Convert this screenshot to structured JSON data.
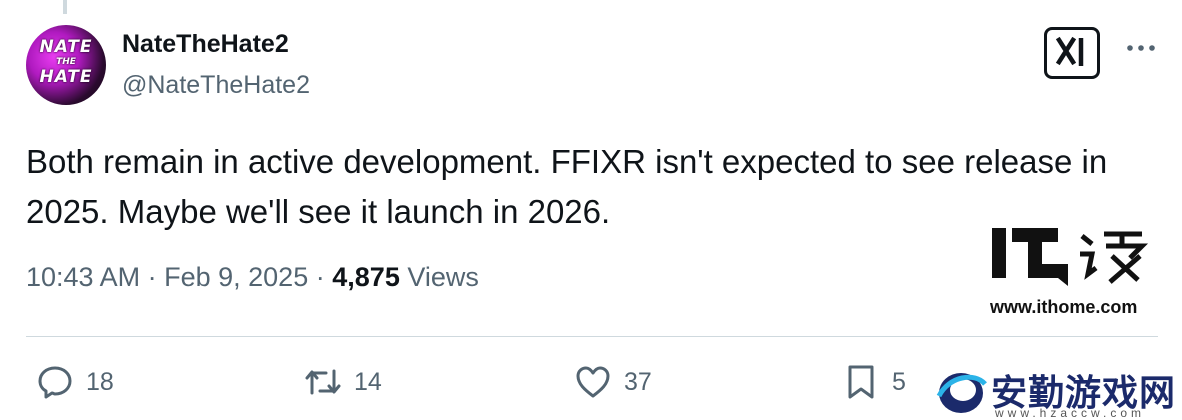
{
  "author": {
    "display_name": "NateTheHate2",
    "handle": "@NateTheHate2",
    "avatar_text": [
      "NATE",
      "THE",
      "HATE"
    ]
  },
  "tweet": {
    "text": "Both remain in active development. FFIXR isn't expected to see release in 2025. Maybe we'll see it launch in 2026.",
    "time": "10:43 AM",
    "date": "Feb 9, 2025",
    "separator": "·",
    "views_count": "4,875",
    "views_label": "Views"
  },
  "actions": {
    "replies": "18",
    "reposts": "14",
    "likes": "37",
    "bookmarks": "5"
  },
  "icons": [
    "grok-icon",
    "more-icon",
    "reply-icon",
    "repost-icon",
    "like-icon",
    "bookmark-icon"
  ],
  "watermarks": {
    "ithome_url": "www.ithome.com",
    "site_title": "安勤游戏网",
    "site_url": "www.hzaccw.com"
  },
  "colors": {
    "text": "#0f1419",
    "secondary": "#536471",
    "divider": "#cfd9de",
    "avatar_accent": "#e83cf0"
  }
}
